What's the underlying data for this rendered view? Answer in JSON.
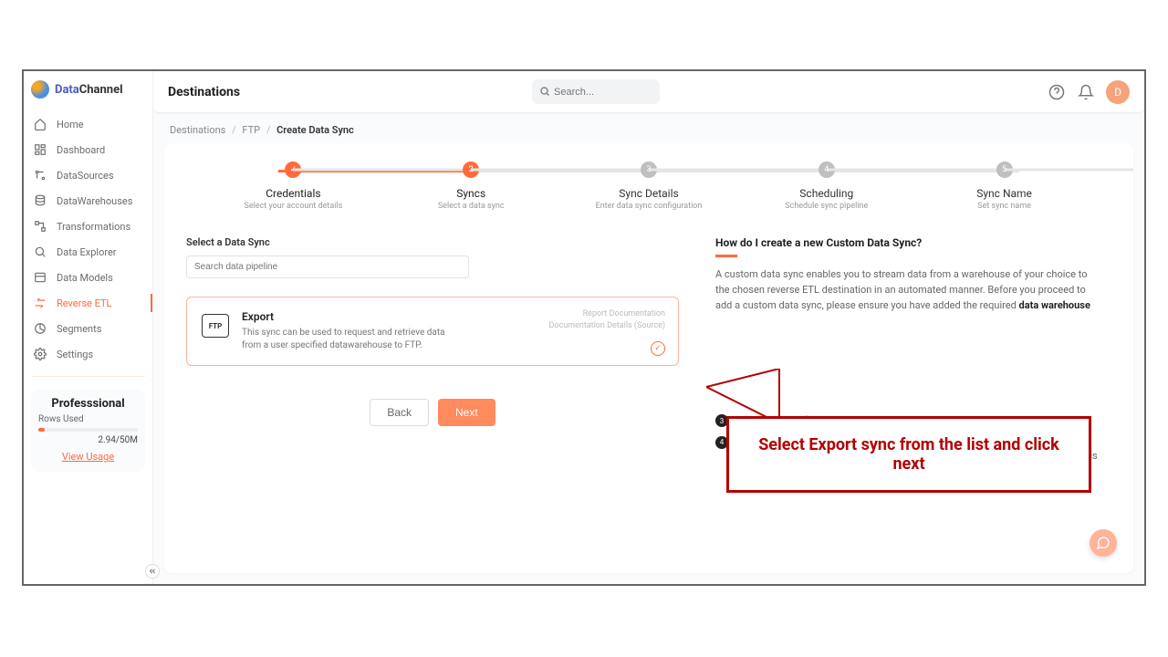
{
  "brand": {
    "part1": "Data",
    "part2": "Channel"
  },
  "sidebar": {
    "items": [
      {
        "label": "Home"
      },
      {
        "label": "Dashboard"
      },
      {
        "label": "DataSources"
      },
      {
        "label": "DataWarehouses"
      },
      {
        "label": "Transformations"
      },
      {
        "label": "Data Explorer"
      },
      {
        "label": "Data Models"
      },
      {
        "label": "Reverse ETL"
      },
      {
        "label": "Segments"
      },
      {
        "label": "Settings"
      }
    ],
    "plan": {
      "title": "Professsional",
      "rows_label": "Rows Used",
      "usage_text": "2.94/50M",
      "view_link": "View Usage"
    }
  },
  "header": {
    "page_title": "Destinations",
    "search_placeholder": "Search...",
    "avatar_initial": "D"
  },
  "breadcrumb": {
    "a": "Destinations",
    "b": "FTP",
    "c": "Create Data Sync"
  },
  "stepper": [
    {
      "num": "✓",
      "title": "Credentials",
      "sub": "Select your account details"
    },
    {
      "num": "2",
      "title": "Syncs",
      "sub": "Select a data sync"
    },
    {
      "num": "3",
      "title": "Sync Details",
      "sub": "Enter data sync configuration"
    },
    {
      "num": "4",
      "title": "Scheduling",
      "sub": "Schedule sync pipeline"
    },
    {
      "num": "5",
      "title": "Sync Name",
      "sub": "Set sync name"
    }
  ],
  "select_sync": {
    "heading": "Select a Data Sync",
    "search_placeholder": "Search data pipeline",
    "card": {
      "icon_label": "FTP",
      "title": "Export",
      "desc": "This sync can be used to request and retrieve data from a user specified datawarehouse to FTP.",
      "link1": "Report Documentation",
      "link2": "Documentation Details (Source)"
    },
    "back": "Back",
    "next": "Next"
  },
  "help": {
    "title": "How do I create a new Custom Data Sync?",
    "para_a": "A custom data sync enables you to stream data from a warehouse of your choice to the chosen reverse ETL destination in an automated manner. Before you proceed to add a custom data sync, please ensure you have added the required ",
    "para_b": "data warehouse",
    "step3": "Choose a Sync from the list and click 'Next'.",
    "step4": "Configure the sync by selecting the data model, specifying the insert mode and defining other report parameters. Detailed process of configuring individual syncs is described in each destination."
  },
  "callout": "Select Export  sync from the list and click next"
}
